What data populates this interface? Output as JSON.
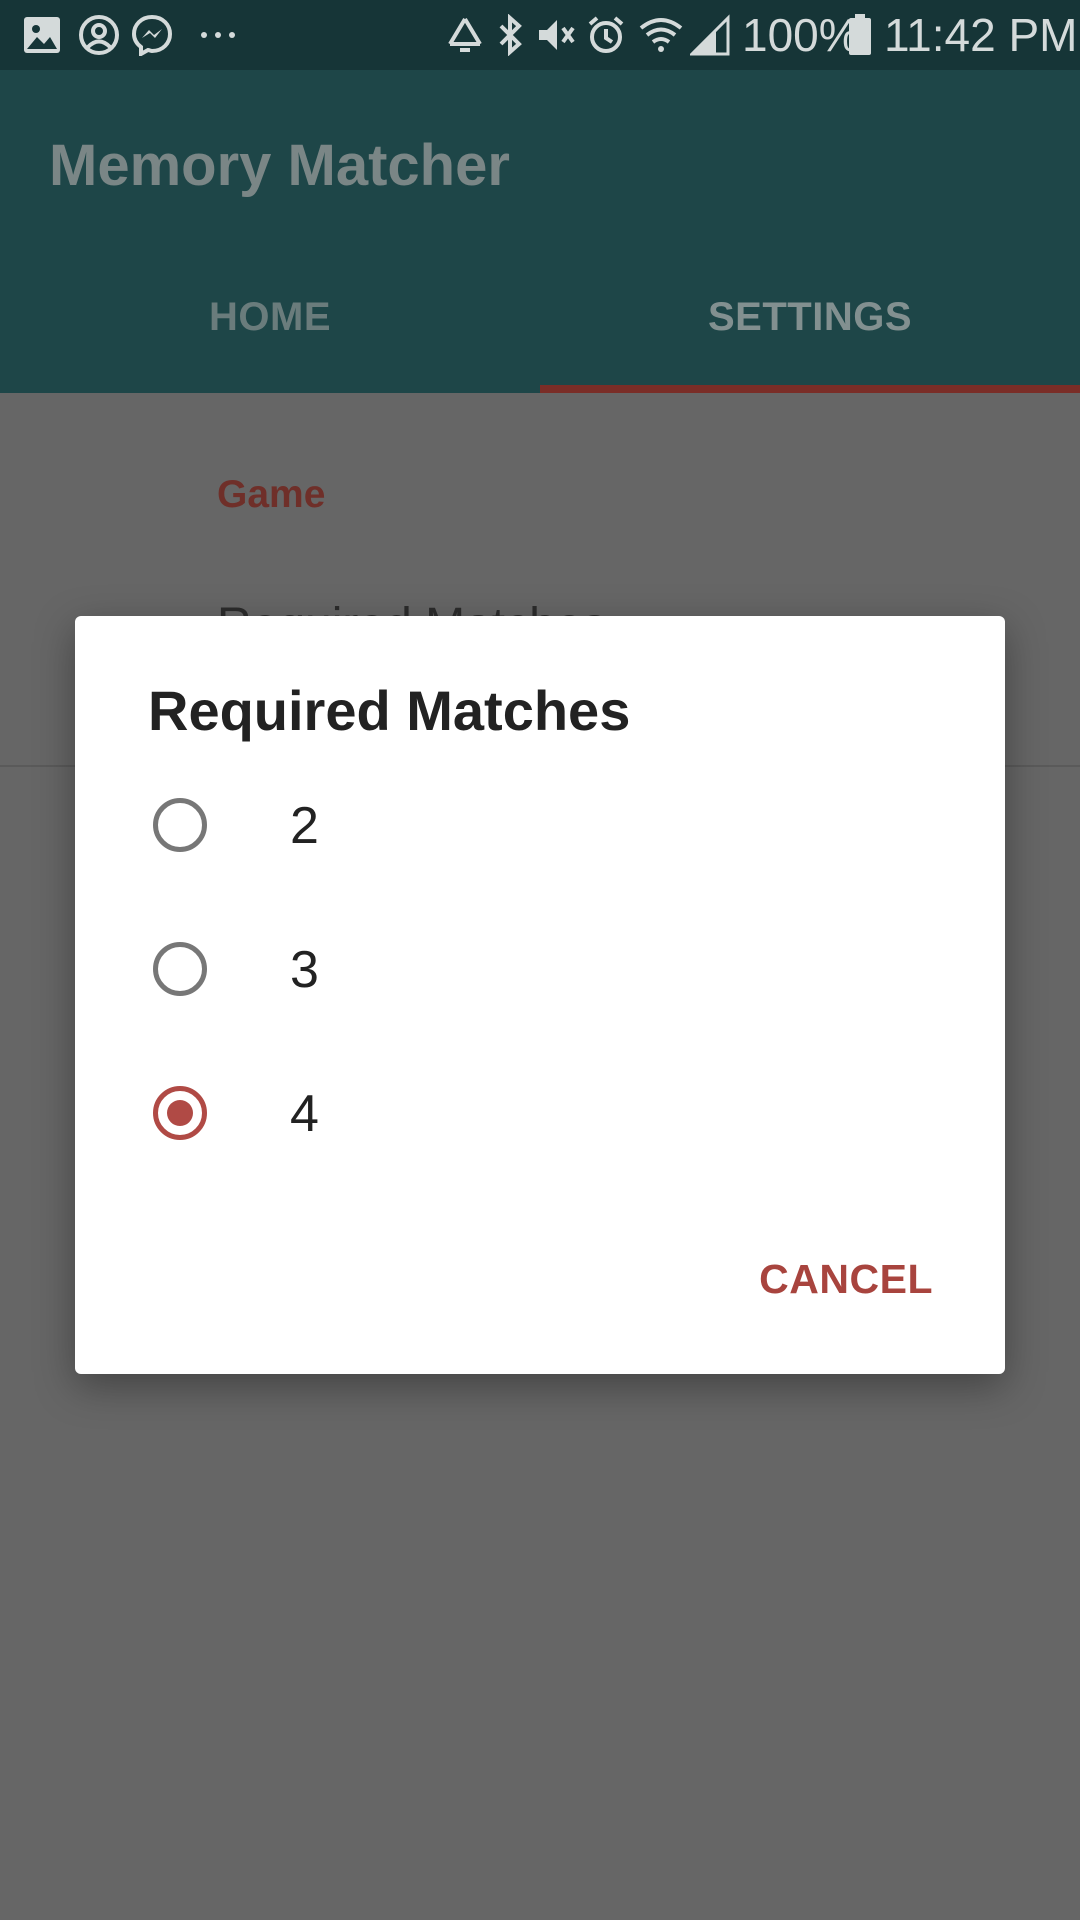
{
  "status_bar": {
    "icons_left": [
      "image-icon",
      "account-circle-icon",
      "messenger-icon",
      "more-dots-icon"
    ],
    "icons_right": [
      "recycle-icon",
      "bluetooth-icon",
      "vibrate-icon",
      "alarm-icon",
      "wifi-icon",
      "signal-icon"
    ],
    "battery": "100%",
    "time": "11:42 PM"
  },
  "app_bar": {
    "title": "Memory Matcher",
    "tabs": [
      {
        "label": "HOME",
        "selected": false
      },
      {
        "label": "SETTINGS",
        "selected": true
      }
    ]
  },
  "settings": {
    "category": "Game",
    "preference_title": "Required Matches"
  },
  "dialog": {
    "title": "Required Matches",
    "options": [
      {
        "label": "2",
        "checked": false
      },
      {
        "label": "3",
        "checked": false
      },
      {
        "label": "4",
        "checked": true
      }
    ],
    "cancel_label": "CANCEL"
  },
  "colors": {
    "accent": "#b04a45",
    "primary": "#2a6e70",
    "scrim_background": "#666666"
  }
}
